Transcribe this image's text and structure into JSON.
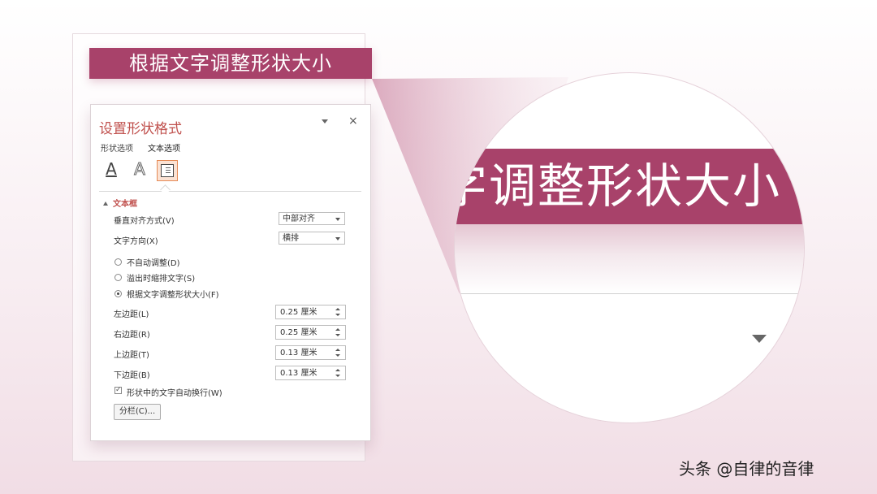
{
  "banner": {
    "text": "根据文字调整形状大小"
  },
  "panel": {
    "title": "设置形状格式",
    "close_glyph": "×",
    "tabs": [
      {
        "label": "形状选项"
      },
      {
        "label": "文本选项"
      }
    ],
    "icons": [
      "text-fill-icon",
      "text-outline-icon",
      "text-box-icon"
    ],
    "section": "文本框",
    "vertical_align": {
      "label": "垂直对齐方式(V)",
      "value": "中部对齐"
    },
    "text_direction": {
      "label": "文字方向(X)",
      "value": "横排"
    },
    "autofit_options": [
      {
        "label": "不自动调整(D)",
        "selected": false
      },
      {
        "label": "溢出时缩排文字(S)",
        "selected": false
      },
      {
        "label": "根据文字调整形状大小(F)",
        "selected": true
      }
    ],
    "margins": [
      {
        "label": "左边距(L)",
        "value": "0.25 厘米"
      },
      {
        "label": "右边距(R)",
        "value": "0.25 厘米"
      },
      {
        "label": "上边距(T)",
        "value": "0.13 厘米"
      },
      {
        "label": "下边距(B)",
        "value": "0.13 厘米"
      }
    ],
    "wrap_text": {
      "label": "形状中的文字自动换行(W)",
      "checked": true,
      "glyph": "✓"
    },
    "columns_button": "分栏(C)..."
  },
  "magnifier": {
    "text": "字调整形状大小"
  },
  "watermark": "头条 @自律的音律",
  "colors": {
    "accent": "#a8426a",
    "title": "#c0504d",
    "selected_icon_bg": "#fbe2d3"
  }
}
